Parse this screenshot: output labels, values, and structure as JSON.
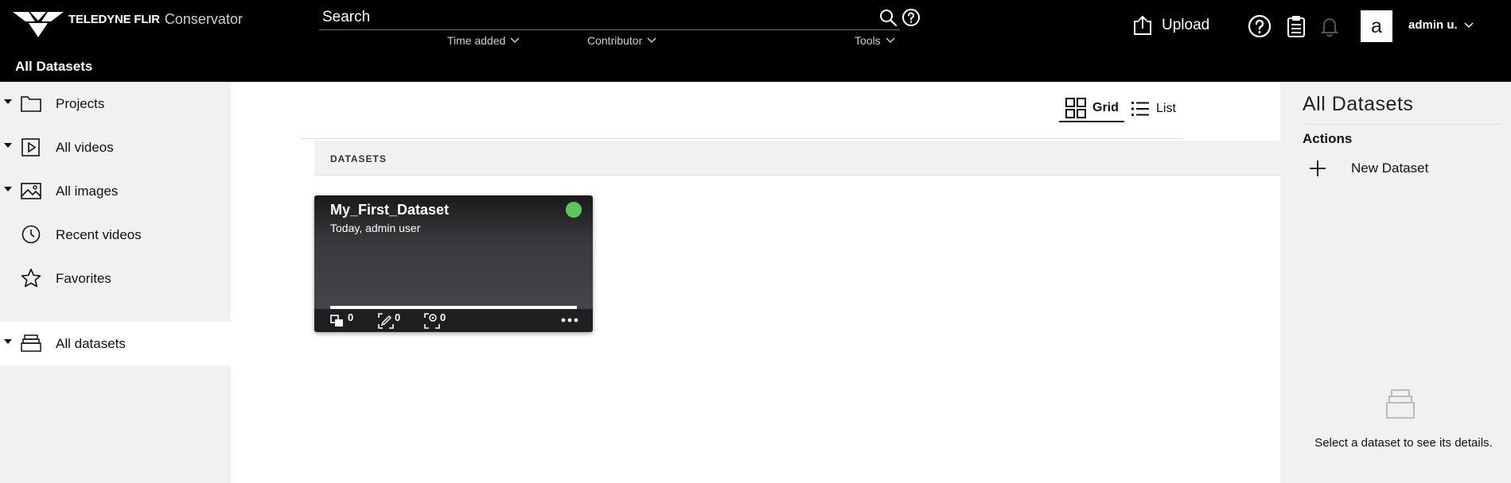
{
  "header": {
    "brand": "TELEDYNE FLIR",
    "product": "Conservator",
    "page_title": "All Datasets",
    "search": {
      "placeholder": "Search"
    },
    "filters": [
      {
        "label": "Time added"
      },
      {
        "label": "Contributor"
      },
      {
        "label": "Tools"
      }
    ],
    "upload_label": "Upload",
    "avatar_letter": "a",
    "user_label": "admin u."
  },
  "sidebar": {
    "items": [
      {
        "label": "Projects",
        "icon": "folder-icon",
        "expandable": true
      },
      {
        "label": "All videos",
        "icon": "video-icon",
        "expandable": true
      },
      {
        "label": "All images",
        "icon": "image-icon",
        "expandable": true
      },
      {
        "label": "Recent videos",
        "icon": "clock-icon",
        "expandable": false
      },
      {
        "label": "Favorites",
        "icon": "star-icon",
        "expandable": false
      },
      {
        "label": "All datasets",
        "icon": "dataset-icon",
        "expandable": true,
        "active": true
      }
    ]
  },
  "main": {
    "view_toggle": {
      "grid_label": "Grid",
      "list_label": "List",
      "selected": "Grid"
    },
    "section_title": "DATASETS",
    "datasets": [
      {
        "name": "My_First_Dataset",
        "subtitle": "Today, admin user",
        "status_color": "#5cc65c",
        "frames": "0",
        "annotations": "0",
        "qa": "0"
      }
    ]
  },
  "right_panel": {
    "title": "All Datasets",
    "actions_heading": "Actions",
    "new_dataset_label": "New Dataset",
    "empty_message": "Select a dataset to see its details."
  },
  "colors": {
    "header_bg": "#000000",
    "panel_bg": "#f1f1f0",
    "status_green": "#5cc65c"
  }
}
